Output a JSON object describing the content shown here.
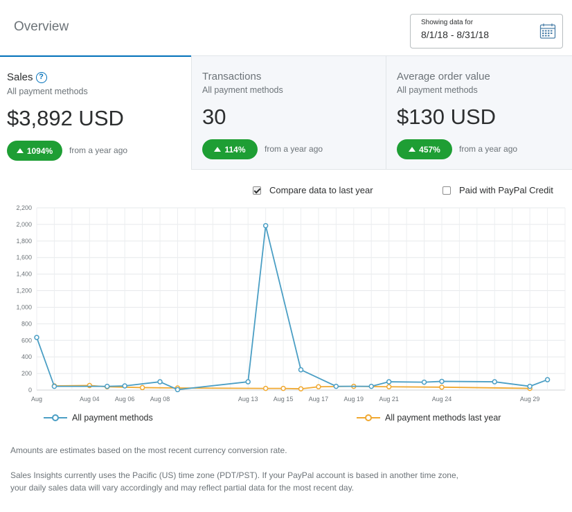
{
  "header": {
    "title": "Overview",
    "date_label": "Showing data for",
    "date_range": "8/1/18 - 8/31/18"
  },
  "cards": [
    {
      "title": "Sales",
      "subtitle": "All payment methods",
      "value": "$3,892 USD",
      "change": "1094%",
      "note": "from a year ago"
    },
    {
      "title": "Transactions",
      "subtitle": "All payment methods",
      "value": "30",
      "change": "114%",
      "note": "from a year ago"
    },
    {
      "title": "Average order value",
      "subtitle": "All payment methods",
      "value": "$130 USD",
      "change": "457%",
      "note": "from a year ago"
    }
  ],
  "options": {
    "compare_label": "Compare data to last year",
    "compare_checked": true,
    "credit_label": "Paid with PayPal Credit",
    "credit_checked": false
  },
  "colors": {
    "current": "#4a9ec4",
    "last_year": "#f0a830",
    "positive": "#1e9e34",
    "accent": "#0070ba"
  },
  "chart_data": {
    "type": "line",
    "x_tick_labels": [
      {
        "day": 1,
        "label": "Aug"
      },
      {
        "day": 4,
        "label": "Aug 04"
      },
      {
        "day": 6,
        "label": "Aug 06"
      },
      {
        "day": 8,
        "label": "Aug 08"
      },
      {
        "day": 13,
        "label": "Aug 13"
      },
      {
        "day": 15,
        "label": "Aug 15"
      },
      {
        "day": 17,
        "label": "Aug 17"
      },
      {
        "day": 19,
        "label": "Aug 19"
      },
      {
        "day": 21,
        "label": "Aug 21"
      },
      {
        "day": 24,
        "label": "Aug 24"
      },
      {
        "day": 29,
        "label": "Aug 29"
      }
    ],
    "xlim": [
      1,
      31
    ],
    "ylim": [
      0,
      2200
    ],
    "y_ticks": [
      0,
      200,
      400,
      600,
      800,
      1000,
      1200,
      1400,
      1600,
      1800,
      2000,
      2200
    ],
    "y_tick_labels": [
      "0",
      "200",
      "400",
      "600",
      "800",
      "1,000",
      "1,200",
      "1,400",
      "1,600",
      "1,800",
      "2,000",
      "2,200"
    ],
    "grid": true,
    "series": [
      {
        "name": "All payment methods",
        "points": [
          [
            1,
            635
          ],
          [
            2,
            45
          ],
          [
            5,
            45
          ],
          [
            6,
            50
          ],
          [
            8,
            100
          ],
          [
            9,
            5
          ],
          [
            13,
            100
          ],
          [
            14,
            1985
          ],
          [
            16,
            245
          ],
          [
            18,
            45
          ],
          [
            20,
            45
          ],
          [
            21,
            100
          ],
          [
            23,
            95
          ],
          [
            24,
            105
          ],
          [
            27,
            100
          ],
          [
            29,
            45
          ],
          [
            30,
            125
          ]
        ]
      },
      {
        "name": "All payment methods last year",
        "points": [
          [
            2,
            50
          ],
          [
            4,
            55
          ],
          [
            5,
            40
          ],
          [
            7,
            30
          ],
          [
            9,
            25
          ],
          [
            14,
            20
          ],
          [
            15,
            20
          ],
          [
            16,
            15
          ],
          [
            17,
            40
          ],
          [
            19,
            45
          ],
          [
            21,
            40
          ],
          [
            24,
            35
          ],
          [
            29,
            20
          ]
        ]
      }
    ]
  },
  "footnotes": {
    "line1": "Amounts are estimates based on the most recent currency conversion rate.",
    "line2": "Sales Insights currently uses the Pacific (US) time zone (PDT/PST). If your PayPal account is based in another time zone,",
    "line3": "your daily sales data will vary accordingly and may reflect partial data for the most recent day."
  }
}
